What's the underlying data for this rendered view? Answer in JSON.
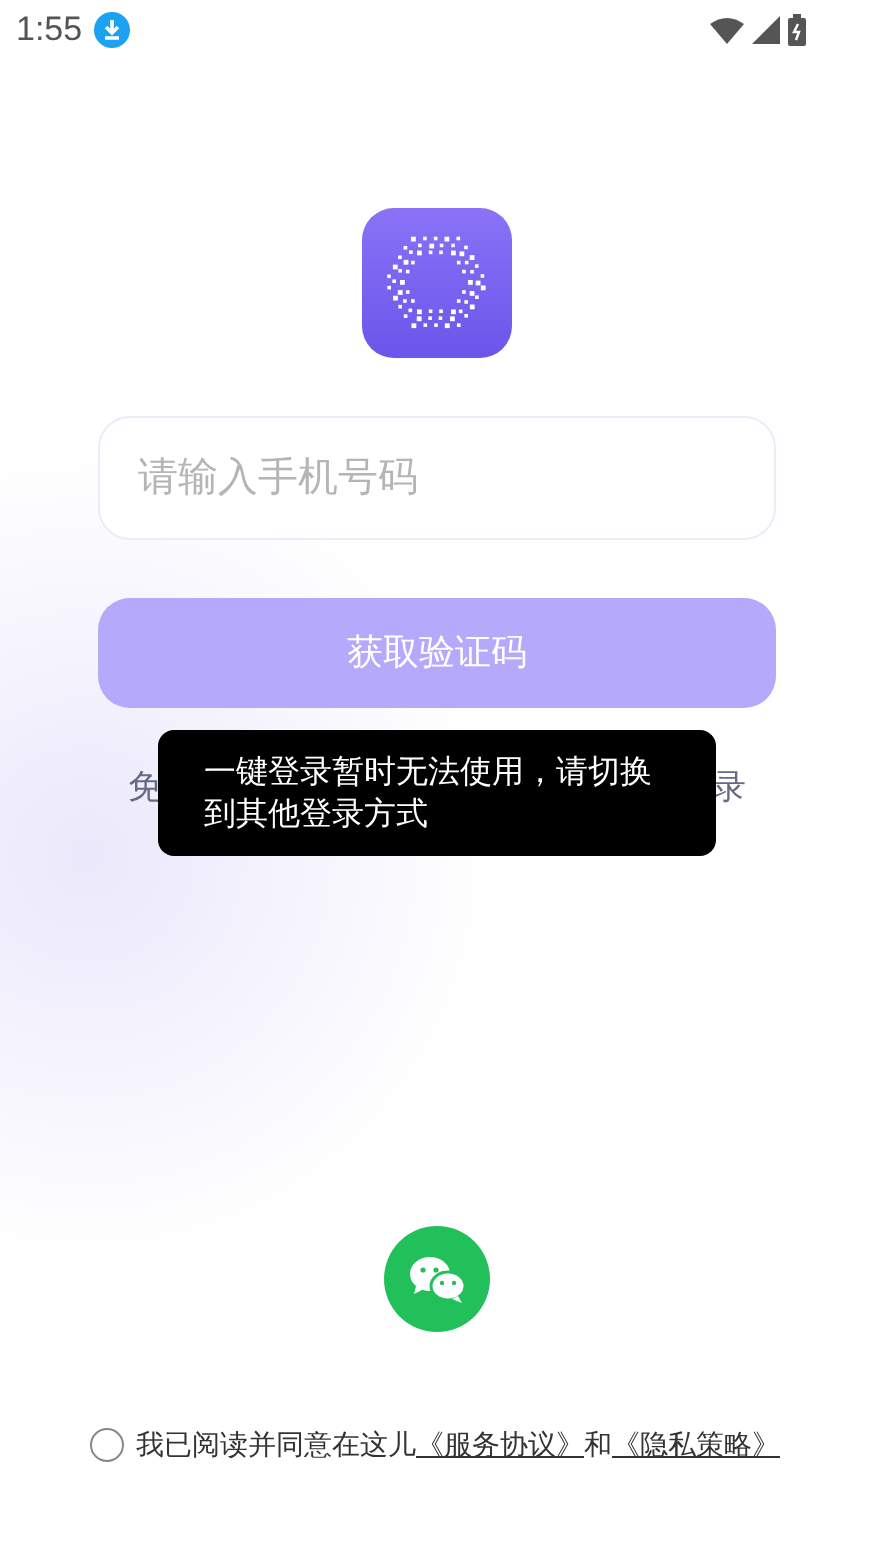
{
  "status_bar": {
    "time": "1:55"
  },
  "phone_field": {
    "placeholder": "请输入手机号码"
  },
  "get_code_button": {
    "label": "获取验证码",
    "disabled": true
  },
  "one_click_row": {
    "left_visible": "免",
    "right_visible": "录"
  },
  "toast": {
    "text": "一键登录暂时无法使用，请切换到其他登录方式"
  },
  "agreement": {
    "checked": false,
    "prefix": "我已阅读并同意在这儿",
    "terms_link": "《服务协议》",
    "joiner": "和",
    "privacy_link": "《隐私策略》"
  }
}
